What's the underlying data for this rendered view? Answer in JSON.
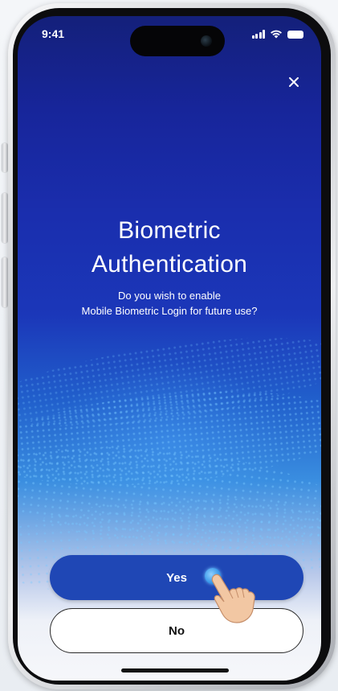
{
  "status_bar": {
    "time": "9:41"
  },
  "dialog": {
    "close_icon": "close-icon",
    "title_lines": [
      "Biometric",
      "Authentication"
    ],
    "subtitle_lines": [
      "Do you wish to enable",
      "Mobile Biometric Login for future use?"
    ],
    "yes_label": "Yes",
    "no_label": "No"
  },
  "colors": {
    "background_top": "#14207a",
    "background_mid": "#1b37b9",
    "accent_button": "#1f47b5",
    "button_text_primary": "#ffffff",
    "secondary_button_bg": "#ffffff",
    "secondary_button_text": "#111111"
  }
}
